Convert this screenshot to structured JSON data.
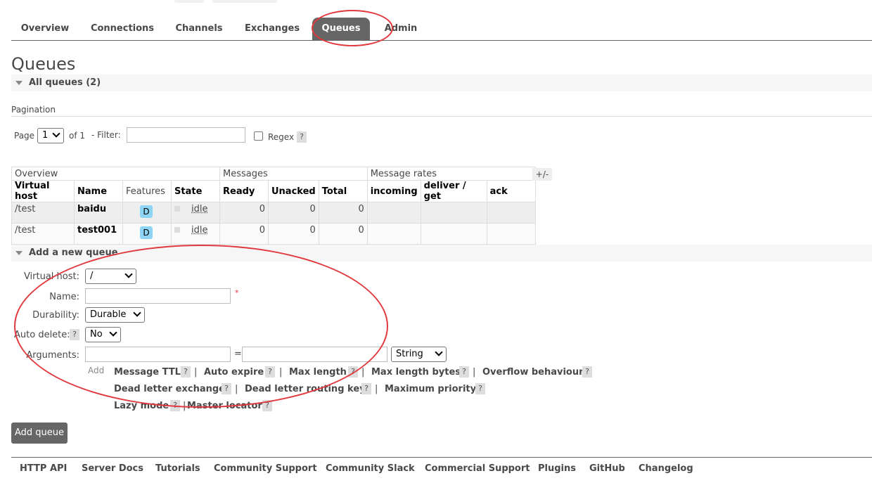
{
  "nav": {
    "tabs": [
      {
        "label": "Overview"
      },
      {
        "label": "Connections"
      },
      {
        "label": "Channels"
      },
      {
        "label": "Exchanges"
      },
      {
        "label": "Queues",
        "active": true
      },
      {
        "label": "Admin"
      }
    ]
  },
  "page_title": "Queues",
  "all_queues": {
    "label": "All queues (2)"
  },
  "pagination": {
    "heading": "Pagination",
    "page_label": "Page",
    "page_value": "1",
    "of_label": "of 1",
    "filter_label": "- Filter:",
    "filter_value": "",
    "regex_label": "Regex",
    "help": "?"
  },
  "table": {
    "groups": [
      "Overview",
      "Messages",
      "Message rates"
    ],
    "toggle_columns": "+/-",
    "headers": [
      "Virtual host",
      "Name",
      "Features",
      "State",
      "Ready",
      "Unacked",
      "Total",
      "incoming",
      "deliver / get",
      "ack"
    ],
    "rows": [
      {
        "vhost": "/test",
        "name": "baidu",
        "feature": "D",
        "state": "idle",
        "ready": "0",
        "unacked": "0",
        "total": "0"
      },
      {
        "vhost": "/test",
        "name": "test001",
        "feature": "D",
        "state": "idle",
        "ready": "0",
        "unacked": "0",
        "total": "0"
      }
    ]
  },
  "add_queue": {
    "section_label": "Add a new queue",
    "virtual_host_label": "Virtual host:",
    "virtual_host_value": "/",
    "name_label": "Name:",
    "name_value": "",
    "required_mark": "*",
    "durability_label": "Durability:",
    "durability_value": "Durable",
    "auto_delete_label": "Auto delete:",
    "auto_delete_value": "No",
    "arguments_label": "Arguments:",
    "equals": "=",
    "arg_type_value": "String",
    "add_label": "Add",
    "arg_links": [
      "Message TTL",
      "Auto expire",
      "Max length",
      "Max length bytes",
      "Overflow behaviour",
      "Dead letter exchange",
      "Dead letter routing key",
      "Maximum priority",
      "Lazy mode",
      "Master locator"
    ],
    "separator": "|",
    "help": "?",
    "submit_label": "Add queue"
  },
  "footer": {
    "links": [
      "HTTP API",
      "Server Docs",
      "Tutorials",
      "Community Support",
      "Community Slack",
      "Commercial Support",
      "Plugins",
      "GitHub",
      "Changelog"
    ]
  },
  "colors": {
    "accent": "#666666",
    "annotation": "#e0393e",
    "feature_badge": "#8ed4f5"
  }
}
